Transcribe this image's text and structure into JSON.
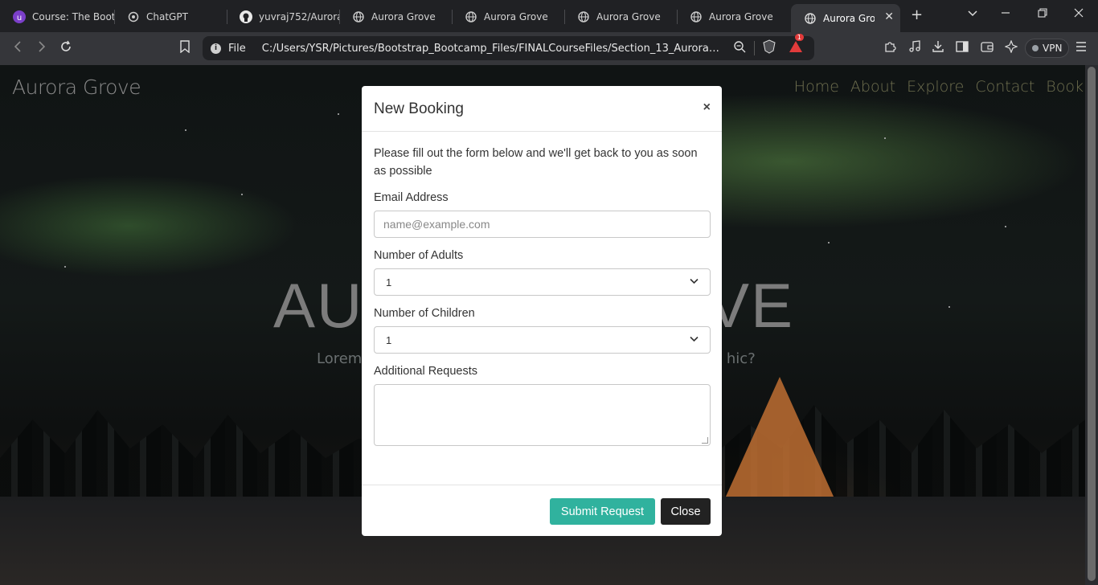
{
  "browser": {
    "tabs": [
      {
        "title": "Course: The Boot",
        "icon": "course-icon",
        "active": false
      },
      {
        "title": "ChatGPT",
        "icon": "chatgpt-icon",
        "active": false
      },
      {
        "title": "yuvraj752/Aurora",
        "icon": "github-icon",
        "active": false
      },
      {
        "title": "Aurora Grove",
        "icon": "globe-icon",
        "active": false
      },
      {
        "title": "Aurora Grove",
        "icon": "globe-icon",
        "active": false
      },
      {
        "title": "Aurora Grove",
        "icon": "globe-icon",
        "active": false
      },
      {
        "title": "Aurora Grove",
        "icon": "globe-icon",
        "active": false
      },
      {
        "title": "Aurora Grove",
        "icon": "globe-icon",
        "active": true
      }
    ],
    "new_tab": "+",
    "url_scheme": "File",
    "url": "C:/Users/YSR/Pictures/Bootstrap_Bootcamp_Files/FINALCourseFiles/Section_13_Aurora_Gro...",
    "notification_count": "1",
    "vpn_label": "VPN"
  },
  "site": {
    "brand": "Aurora Grove",
    "nav": [
      "Home",
      "About",
      "Explore",
      "Contact",
      "Book"
    ],
    "hero_title_left": "AU",
    "hero_title_right": "VE",
    "hero_sub_left": "Lorem",
    "hero_sub_right": "es, hic?"
  },
  "modal": {
    "title": "New Booking",
    "close_glyph": "×",
    "intro": "Please fill out the form below and we'll get back to you as soon as possible",
    "email_label": "Email Address",
    "email_placeholder": "name@example.com",
    "adults_label": "Number of Adults",
    "adults_value": "1",
    "children_label": "Number of Children",
    "children_value": "1",
    "requests_label": "Additional Requests",
    "submit_label": "Submit Request",
    "close_label": "Close"
  },
  "colors": {
    "submit": "#30b29e",
    "close": "#222222"
  }
}
